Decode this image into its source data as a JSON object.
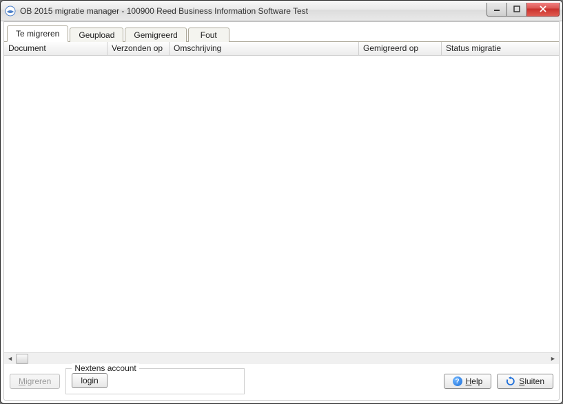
{
  "window": {
    "title": "OB 2015 migratie manager - 100900  Reed Business Information Software Test"
  },
  "tabs": [
    {
      "label": "Te migreren",
      "active": true
    },
    {
      "label": "Geupload",
      "active": false
    },
    {
      "label": "Gemigreerd",
      "active": false
    },
    {
      "label": "Fout",
      "active": false
    }
  ],
  "columns": [
    "Document",
    "Verzonden op",
    "Omschrijving",
    "Gemigreerd op",
    "Status migratie"
  ],
  "rows": [],
  "bottom": {
    "migrate_label": "Migreren",
    "account_legend": "Nextens account",
    "login_label": "login",
    "help_label": "Help",
    "close_label": "Sluiten"
  }
}
